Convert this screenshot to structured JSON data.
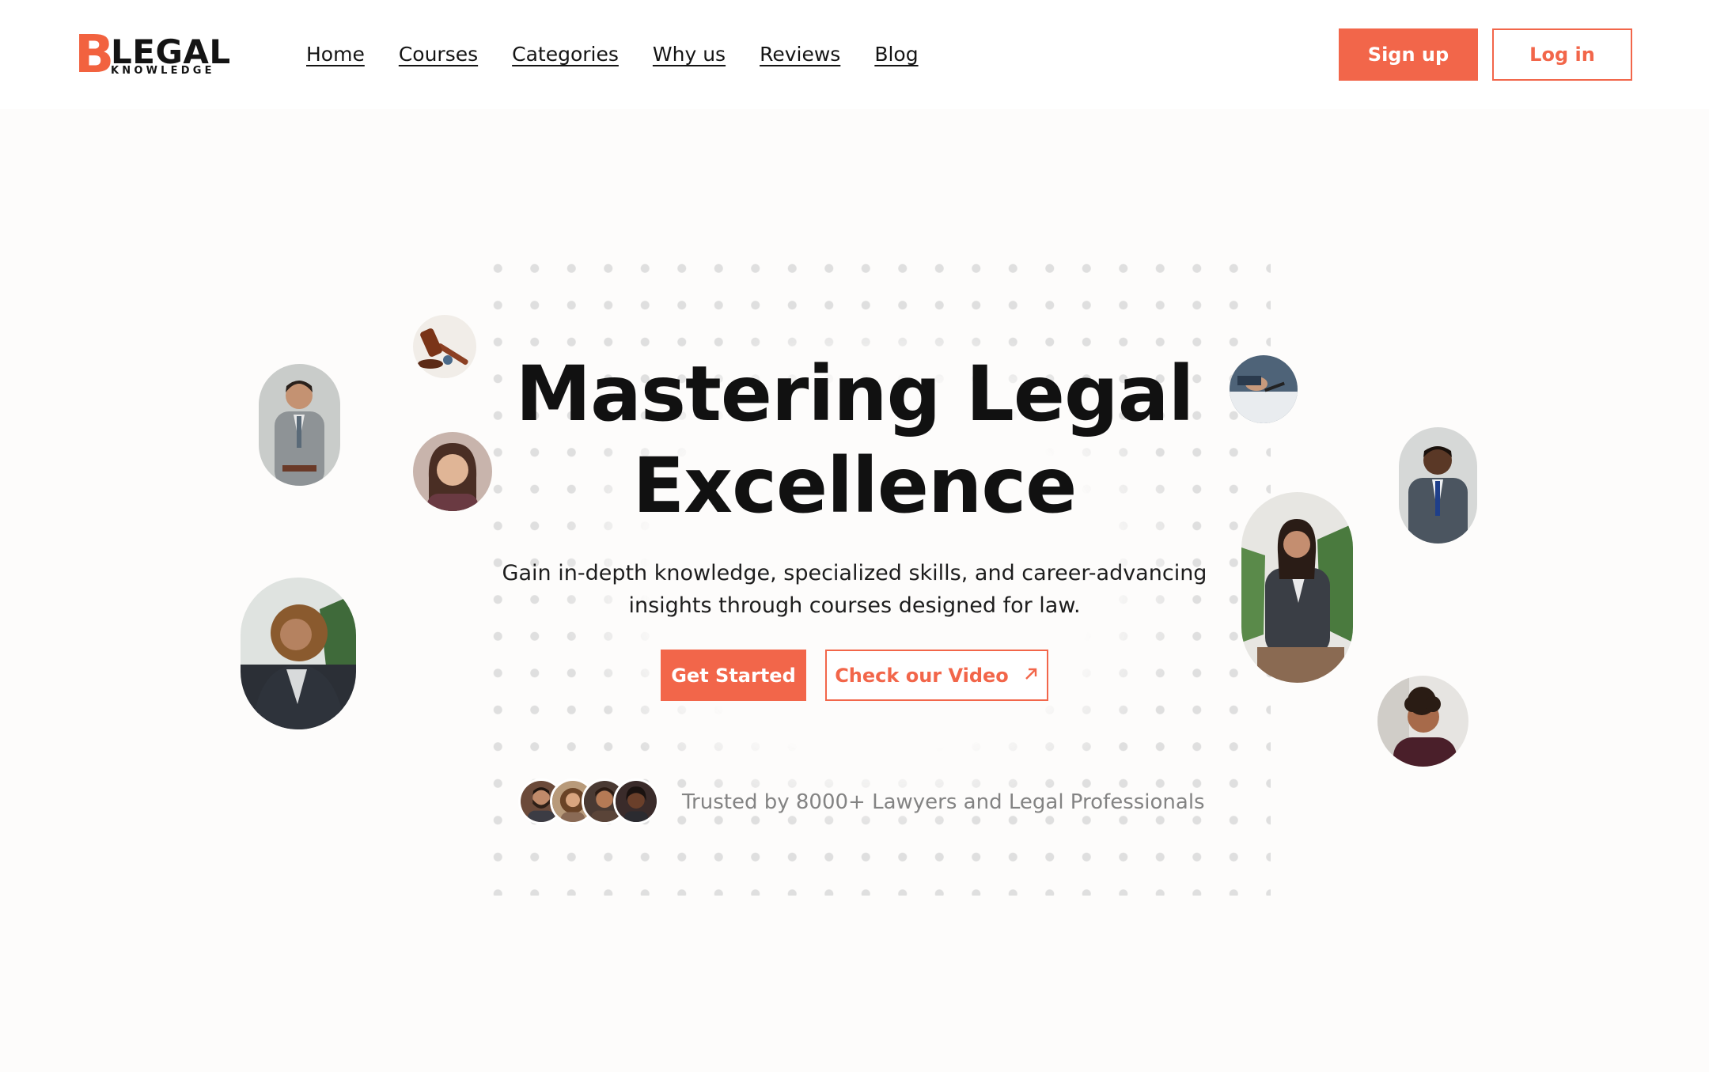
{
  "brand": {
    "logo_mark": "B",
    "logo_word": "LEGAL",
    "logo_sub": "KNOWLEDGE",
    "accent_color": "#f2664a"
  },
  "nav": {
    "items": [
      {
        "label": "Home"
      },
      {
        "label": "Courses"
      },
      {
        "label": "Categories"
      },
      {
        "label": "Why us"
      },
      {
        "label": "Reviews"
      },
      {
        "label": "Blog"
      }
    ]
  },
  "auth": {
    "signup_label": "Sign up",
    "login_label": "Log in"
  },
  "hero": {
    "title_line1": "Mastering Legal",
    "title_line2": "Excellence",
    "subtitle_line1": "Gain in-depth knowledge, specialized skills, and career-advancing",
    "subtitle_line2": "insights through courses designed for law.",
    "cta_primary": "Get Started",
    "cta_secondary": "Check our Video",
    "cta_secondary_icon": "arrow-up-right-icon"
  },
  "trust": {
    "text": "Trusted by 8000+ Lawyers and Legal Professionals",
    "avatars": [
      "avatar-man-beard",
      "avatar-woman-curly",
      "avatar-man-dark-hair",
      "avatar-woman-smiling"
    ]
  },
  "floating_images": [
    "photo-man-grey-suit",
    "photo-gavel",
    "photo-woman-smiling",
    "photo-woman-curly-blazer",
    "photo-hands-writing",
    "photo-man-blue-suit",
    "photo-woman-sitting-office",
    "photo-man-curly-hair"
  ]
}
